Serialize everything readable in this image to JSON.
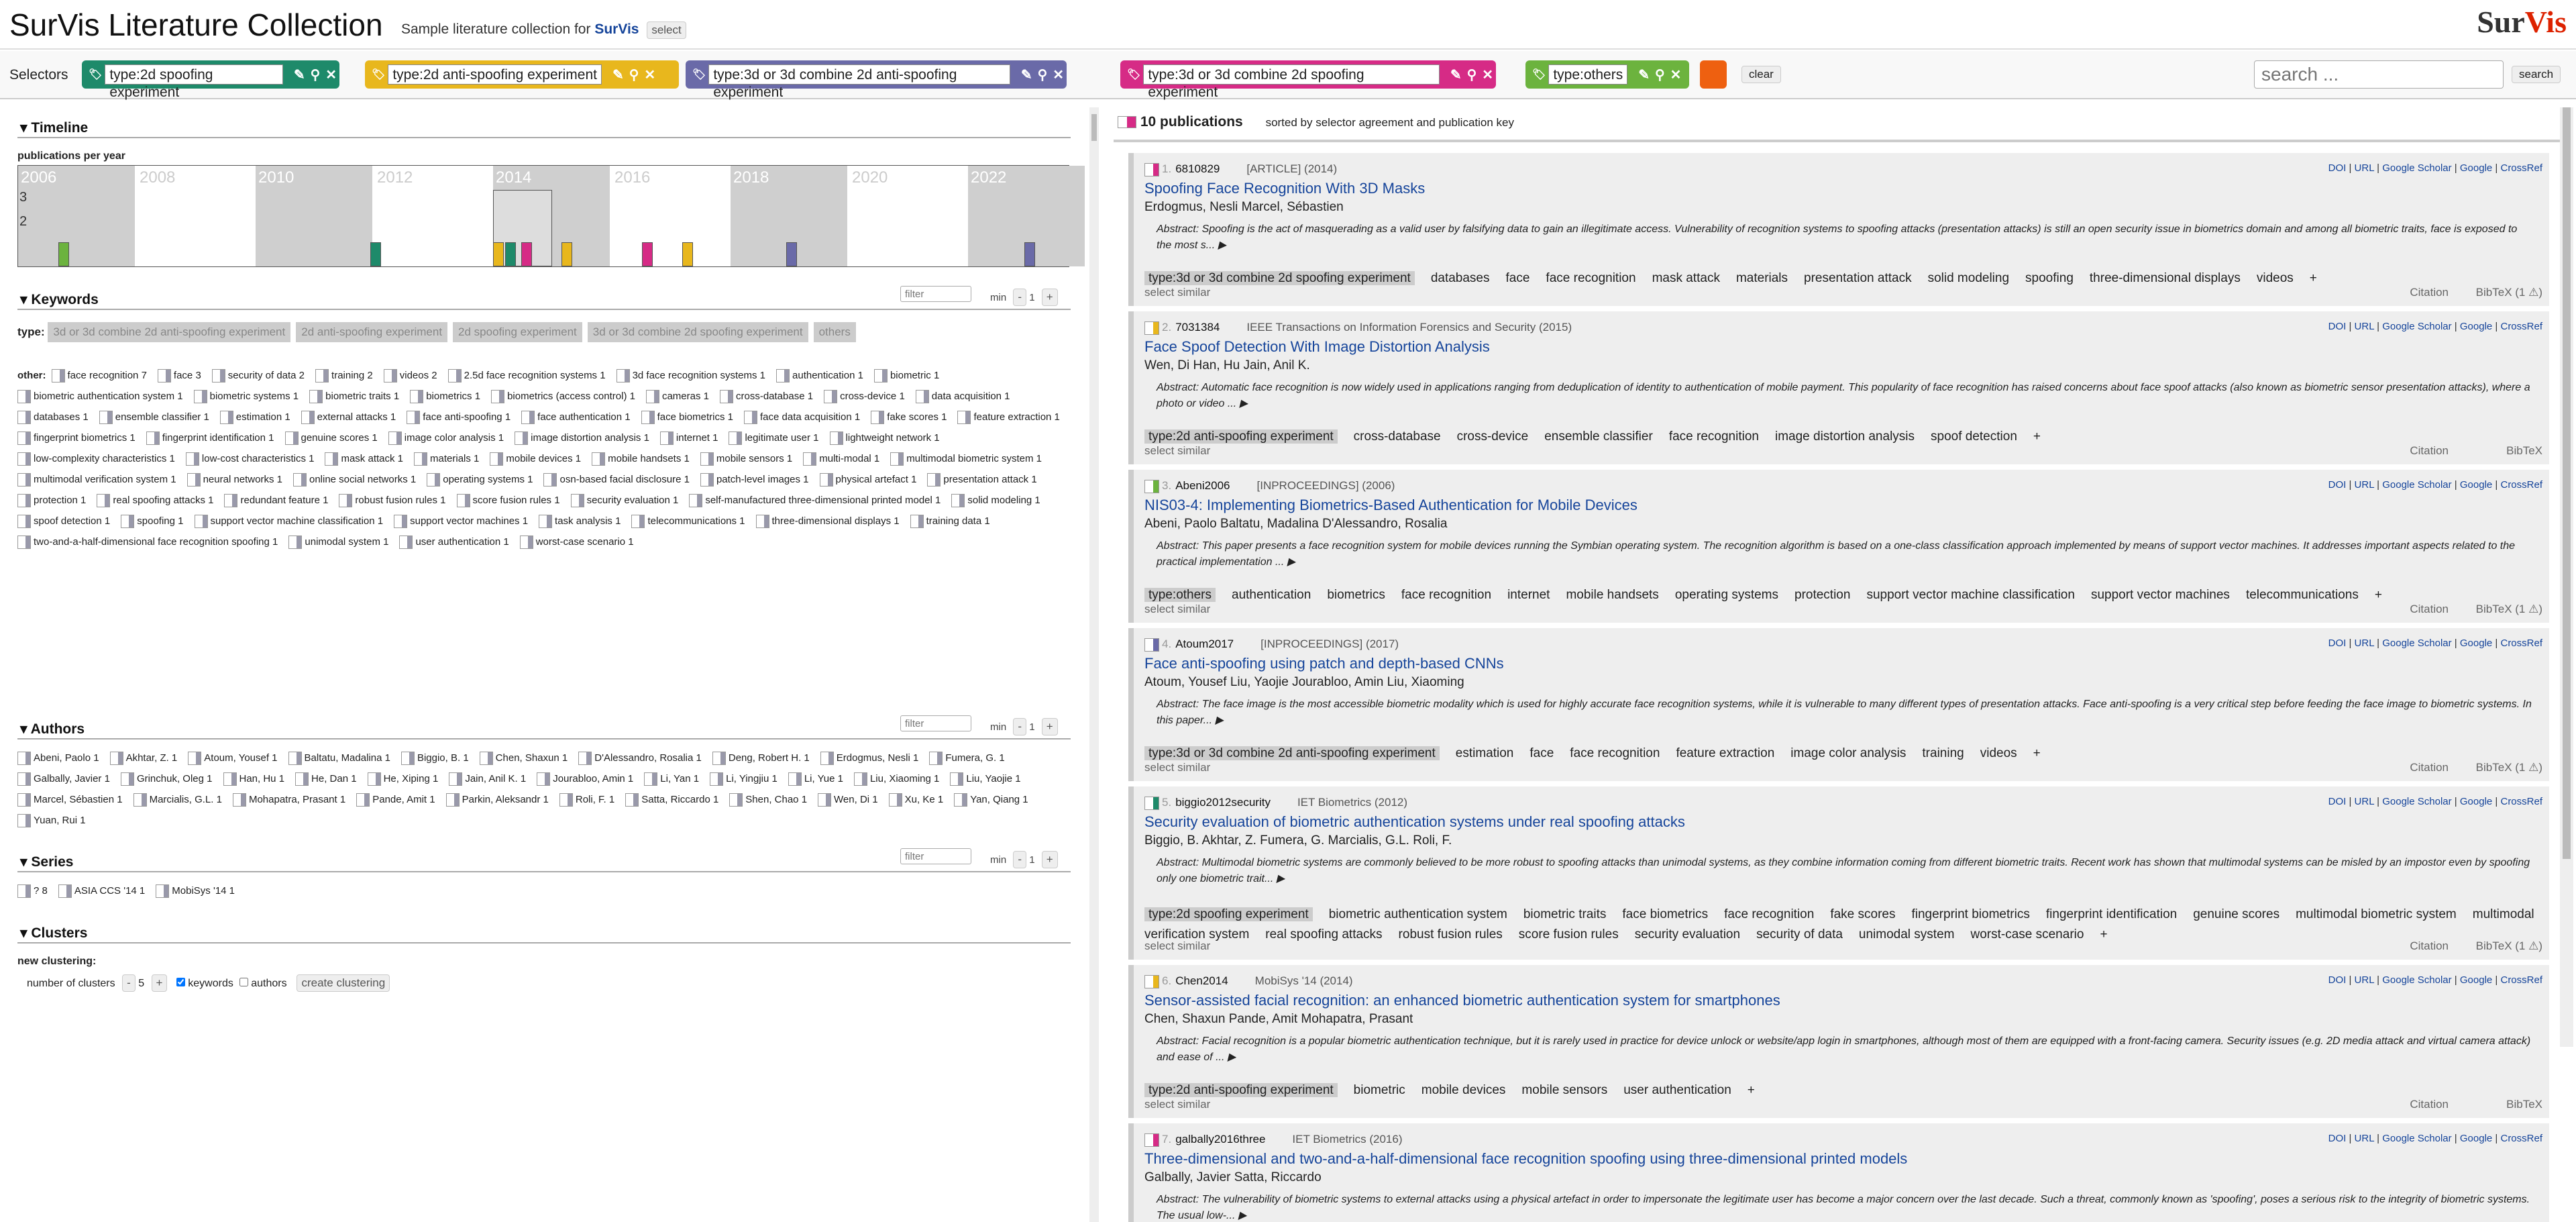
{
  "header": {
    "title": "SurVis Literature Collection",
    "subtitle_pre": "Sample literature collection for",
    "subtitle_app": "SurVis",
    "select": "select",
    "logo_a": "Sur",
    "logo_b": "Vis"
  },
  "selectors": {
    "label": "Selectors",
    "items": [
      {
        "text": "type:2d spoofing experiment",
        "color": "#1e8a6a"
      },
      {
        "text": "type:2d anti-spoofing experiment",
        "color": "#e8b71d"
      },
      {
        "text": "type:3d or 3d combine 2d anti-spoofing experiment",
        "color": "#6a6aa8"
      },
      {
        "text": "type:3d or 3d combine 2d spoofing experiment",
        "color": "#d62b86"
      },
      {
        "text": "type:others",
        "color": "#6cb33e"
      }
    ],
    "extra_color": "#ee6010",
    "clear": "clear",
    "search_placeholder": "search ...",
    "search_btn": "search"
  },
  "timeline": {
    "title": "Timeline",
    "subtitle": "publications per year",
    "years": [
      "2006",
      "2008",
      "2010",
      "2012",
      "2014",
      "2016",
      "2018",
      "2020",
      "2022"
    ],
    "ticks": [
      "3",
      "2"
    ]
  },
  "keywords": {
    "title": "Keywords",
    "filter": "filter",
    "min": "min",
    "min_val": "1",
    "minus": "-",
    "plus": "+",
    "type_label": "type:",
    "types": [
      "3d or 3d combine 2d anti-spoofing experiment",
      "2d anti-spoofing experiment",
      "2d spoofing experiment",
      "3d or 3d combine 2d spoofing experiment",
      "others"
    ],
    "other_label": "other:",
    "items": [
      "face recognition 7",
      "face 3",
      "security of data 2",
      "training 2",
      "videos 2",
      "2.5d face recognition systems 1",
      "3d face recognition systems 1",
      "authentication 1",
      "biometric 1",
      "biometric authentication system 1",
      "biometric systems 1",
      "biometric traits 1",
      "biometrics 1",
      "biometrics (access control) 1",
      "cameras 1",
      "cross-database 1",
      "cross-device 1",
      "data acquisition 1",
      "databases 1",
      "ensemble classifier 1",
      "estimation 1",
      "external attacks 1",
      "face anti-spoofing 1",
      "face authentication 1",
      "face biometrics 1",
      "face data acquisition 1",
      "fake scores 1",
      "feature extraction 1",
      "fingerprint biometrics 1",
      "fingerprint identification 1",
      "genuine scores 1",
      "image color analysis 1",
      "image distortion analysis 1",
      "internet 1",
      "legitimate user 1",
      "lightweight network 1",
      "low-complexity characteristics 1",
      "low-cost characteristics 1",
      "mask attack 1",
      "materials 1",
      "mobile devices 1",
      "mobile handsets 1",
      "mobile sensors 1",
      "multi-modal 1",
      "multimodal biometric system 1",
      "multimodal verification system 1",
      "neural networks 1",
      "online social networks 1",
      "operating systems 1",
      "osn-based facial disclosure 1",
      "patch-level images 1",
      "physical artefact 1",
      "presentation attack 1",
      "protection 1",
      "real spoofing attacks 1",
      "redundant feature 1",
      "robust fusion rules 1",
      "score fusion rules 1",
      "security evaluation 1",
      "self-manufactured three-dimensional printed model 1",
      "solid modeling 1",
      "spoof detection 1",
      "spoofing 1",
      "support vector machine classification 1",
      "support vector machines 1",
      "task analysis 1",
      "telecommunications 1",
      "three-dimensional displays 1",
      "training data 1",
      "two-and-a-half-dimensional face recognition spoofing 1",
      "unimodal system 1",
      "user authentication 1",
      "worst-case scenario 1"
    ]
  },
  "authors": {
    "title": "Authors",
    "filter": "filter",
    "min": "min",
    "min_val": "1",
    "minus": "-",
    "plus": "+",
    "items": [
      "Abeni, Paolo 1",
      "Akhtar, Z. 1",
      "Atoum, Yousef 1",
      "Baltatu, Madalina 1",
      "Biggio, B. 1",
      "Chen, Shaxun 1",
      "D'Alessandro, Rosalia 1",
      "Deng, Robert H. 1",
      "Erdogmus, Nesli 1",
      "Fumera, G. 1",
      "Galbally, Javier 1",
      "Grinchuk, Oleg 1",
      "Han, Hu 1",
      "He, Dan 1",
      "He, Xiping 1",
      "Jain, Anil K. 1",
      "Jourabloo, Amin 1",
      "Li, Yan 1",
      "Li, Yingjiu 1",
      "Li, Yue 1",
      "Liu, Xiaoming 1",
      "Liu, Yaojie 1",
      "Marcel, Sébastien 1",
      "Marcialis, G.L. 1",
      "Mohapatra, Prasant 1",
      "Pande, Amit 1",
      "Parkin, Aleksandr 1",
      "Roli, F. 1",
      "Satta, Riccardo 1",
      "Shen, Chao 1",
      "Wen, Di 1",
      "Xu, Ke 1",
      "Yan, Qiang 1",
      "Yuan, Rui 1"
    ]
  },
  "series": {
    "title": "Series",
    "filter": "filter",
    "min": "min",
    "min_val": "1",
    "minus": "-",
    "plus": "+",
    "items": [
      "? 8",
      "ASIA CCS '14 1",
      "MobiSys '14 1"
    ]
  },
  "clusters": {
    "title": "Clusters",
    "new": "new clustering:",
    "num_label": "number of clusters",
    "minus": "-",
    "num": "5",
    "plus": "+",
    "kw": "keywords",
    "au": "authors",
    "create": "create clustering"
  },
  "pubs": {
    "count": "10 publications",
    "sorted": "sorted by selector agreement and publication key",
    "links": [
      "DOI",
      "URL",
      "Google Scholar",
      "Google",
      "CrossRef"
    ],
    "select_similar": "select similar",
    "citation": "Citation",
    "bibtex": "BibTeX",
    "items": [
      {
        "num": "1.",
        "key": "6810829",
        "venue": "[ARTICLE] (2014)",
        "title": "Spoofing Face Recognition With 3D Masks",
        "authors": "Erdogmus, Nesli   Marcel, Sébastien",
        "abstract": "Abstract: Spoofing is the act of masquerading as a valid user by falsifying data to gain an illegitimate access. Vulnerability of recognition systems to spoofing attacks (presentation attacks) is still an open security issue in biometrics domain and among all biometric traits, face is exposed to the most s... ▶",
        "type": "type:3d or 3d combine 2d spoofing experiment",
        "tags": [
          "databases",
          "face",
          "face recognition",
          "mask attack",
          "materials",
          "presentation attack",
          "solid modeling",
          "spoofing",
          "three-dimensional displays",
          "videos",
          "+"
        ],
        "bib": "BibTeX (1 ⚠)",
        "color": "#d62b86"
      },
      {
        "num": "2.",
        "key": "7031384",
        "venue": "IEEE Transactions on Information Forensics and Security (2015)",
        "title": "Face Spoof Detection With Image Distortion Analysis",
        "authors": "Wen, Di   Han, Hu   Jain, Anil K.",
        "abstract": "Abstract: Automatic face recognition is now widely used in applications ranging from deduplication of identity to authentication of mobile payment. This popularity of face recognition has raised concerns about face spoof attacks (also known as biometric sensor presentation attacks), where a photo or video ... ▶",
        "type": "type:2d anti-spoofing experiment",
        "tags": [
          "cross-database",
          "cross-device",
          "ensemble classifier",
          "face recognition",
          "image distortion analysis",
          "spoof detection",
          "+"
        ],
        "bib": "BibTeX",
        "color": "#e8b71d"
      },
      {
        "num": "3.",
        "key": "Abeni2006",
        "venue": "[INPROCEEDINGS] (2006)",
        "title": "NIS03-4: Implementing Biometrics-Based Authentication for Mobile Devices",
        "authors": "Abeni, Paolo   Baltatu, Madalina   D'Alessandro, Rosalia",
        "abstract": "Abstract: This paper presents a face recognition system for mobile devices running the Symbian operating system. The recognition algorithm is based on a one-class classification approach implemented by means of support vector machines. It addresses important aspects related to the practical implementation ... ▶",
        "type": "type:others",
        "tags": [
          "authentication",
          "biometrics",
          "face recognition",
          "internet",
          "mobile handsets",
          "operating systems",
          "protection",
          "support vector machine classification",
          "support vector machines",
          "telecommunications",
          "+"
        ],
        "bib": "BibTeX (1 ⚠)",
        "color": "#6cb33e"
      },
      {
        "num": "4.",
        "key": "Atoum2017",
        "venue": "[INPROCEEDINGS] (2017)",
        "title": "Face anti-spoofing using patch and depth-based CNNs",
        "authors": "Atoum, Yousef   Liu, Yaojie   Jourabloo, Amin   Liu, Xiaoming",
        "abstract": "Abstract: The face image is the most accessible biometric modality which is used for highly accurate face recognition systems, while it is vulnerable to many different types of presentation attacks. Face anti-spoofing is a very critical step before feeding the face image to biometric systems. In this paper... ▶",
        "type": "type:3d or 3d combine 2d anti-spoofing experiment",
        "tags": [
          "estimation",
          "face",
          "face recognition",
          "feature extraction",
          "image color analysis",
          "training",
          "videos",
          "+"
        ],
        "bib": "BibTeX (1 ⚠)",
        "color": "#6a6aa8"
      },
      {
        "num": "5.",
        "key": "biggio2012security",
        "venue": "IET Biometrics (2012)",
        "title": "Security evaluation of biometric authentication systems under real spoofing attacks",
        "authors": "Biggio, B.   Akhtar, Z.   Fumera, G.   Marcialis, G.L.   Roli, F.",
        "abstract": "Abstract: Multimodal biometric systems are commonly believed to be more robust to spoofing attacks than unimodal systems, as they combine information coming from different biometric traits. Recent work has shown that multimodal systems can be misled by an impostor even by spoofing only one biometric trait... ▶",
        "type": "type:2d spoofing experiment",
        "tags": [
          "biometric authentication system",
          "biometric traits",
          "face biometrics",
          "face recognition",
          "fake scores",
          "fingerprint biometrics",
          "fingerprint identification",
          "genuine scores",
          "multimodal biometric system",
          "multimodal verification system",
          "real spoofing attacks",
          "robust fusion rules",
          "score fusion rules",
          "security evaluation",
          "security of data",
          "unimodal system",
          "worst-case scenario",
          "+"
        ],
        "bib": "BibTeX (1 ⚠)",
        "color": "#1e8a6a"
      },
      {
        "num": "6.",
        "key": "Chen2014",
        "venue": "MobiSys '14 (2014)",
        "title": "Sensor-assisted facial recognition: an enhanced biometric authentication system for smartphones",
        "authors": "Chen, Shaxun   Pande, Amit   Mohapatra, Prasant",
        "abstract": "Abstract: Facial recognition is a popular biometric authentication technique, but it is rarely used in practice for device unlock or website/app login in smartphones, although most of them are equipped with a front-facing camera. Security issues (e.g. 2D media attack and virtual camera attack) and ease of ... ▶",
        "type": "type:2d anti-spoofing experiment",
        "tags": [
          "biometric",
          "mobile devices",
          "mobile sensors",
          "user authentication",
          "+"
        ],
        "bib": "BibTeX",
        "color": "#e8b71d"
      },
      {
        "num": "7.",
        "key": "galbally2016three",
        "venue": "IET Biometrics (2016)",
        "title": "Three-dimensional and two-and-a-half-dimensional face recognition spoofing using three-dimensional printed models",
        "authors": "Galbally, Javier   Satta, Riccardo",
        "abstract": "Abstract: The vulnerability of biometric systems to external attacks using a physical artefact in order to impersonate the legitimate user has become a major concern over the last decade. Such a threat, commonly known as 'spoofing', poses a serious risk to the integrity of biometric systems. The usual low-... ▶",
        "type": "",
        "tags": [],
        "bib": "",
        "color": "#d62b86"
      }
    ]
  }
}
